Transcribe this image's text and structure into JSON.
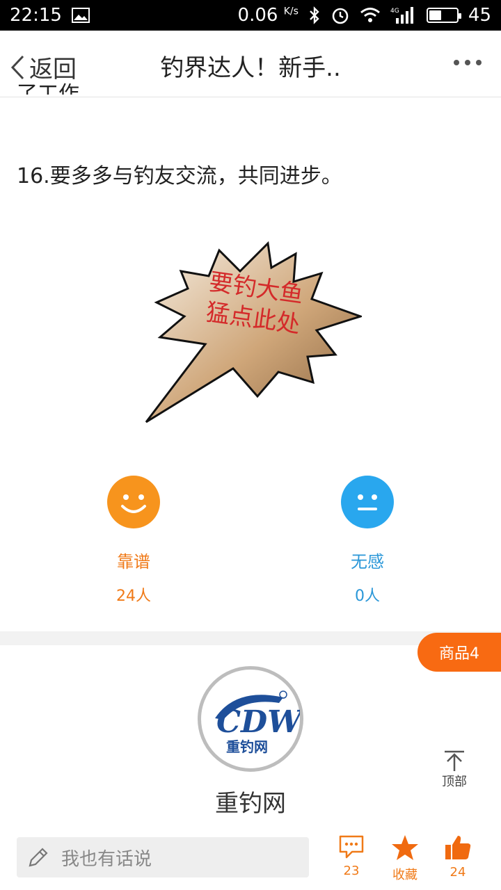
{
  "status_bar": {
    "time": "22:15",
    "net_speed": "0.06",
    "net_speed_unit": "K/s",
    "network_type": "4G",
    "battery_level": "45",
    "battery_fraction": 0.45,
    "icons": [
      "image-icon",
      "bluetooth-icon",
      "alarm-icon",
      "wifi-icon",
      "signal-icon",
      "battery-icon"
    ]
  },
  "nav": {
    "back_label": "返回",
    "title": "钓界达人！新手..",
    "more_icon": "more-dots-icon"
  },
  "article": {
    "partial_line": "了工作。",
    "line_16": "16.要多多与钓友交流，共同进步。"
  },
  "promo": {
    "line1": "要钓大鱼",
    "line2": "猛点此处"
  },
  "reactions": [
    {
      "label": "靠谱",
      "count": "24人",
      "icon": "smile-face-icon",
      "color": "#f7941d"
    },
    {
      "label": "无感",
      "count": "0人",
      "icon": "neutral-face-icon",
      "color": "#29a7ee"
    }
  ],
  "goods_tab": {
    "label": "商品4",
    "color": "#f86a12"
  },
  "site": {
    "logo_text": "CDW",
    "logo_subtitle": "重钓网",
    "name": "重钓网"
  },
  "top_button": {
    "label": "顶部"
  },
  "bottom_bar": {
    "input_placeholder": "我也有话说",
    "comments_count": "23",
    "favorite_label": "收藏",
    "likes_count": "24"
  }
}
